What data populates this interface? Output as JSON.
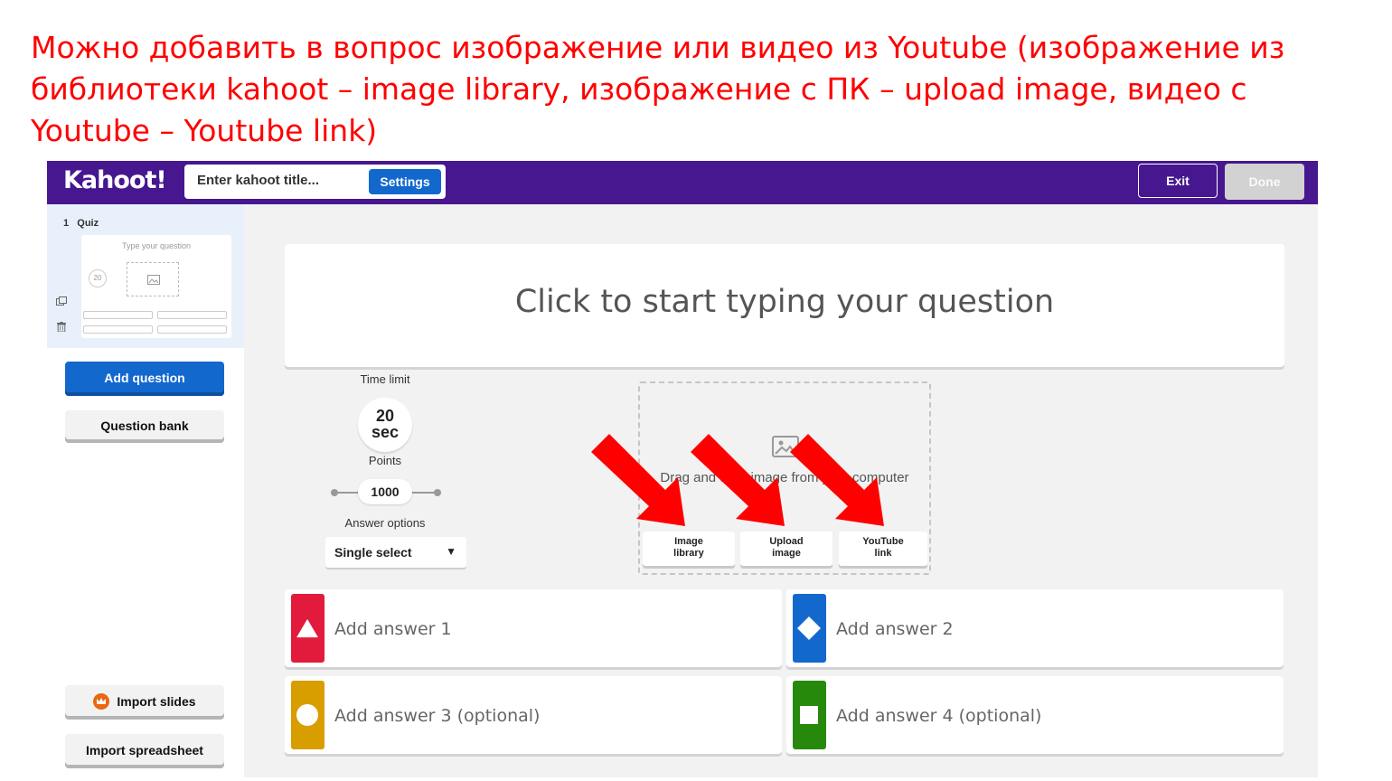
{
  "caption": {
    "text": "Можно добавить в вопрос изображение или видео из Youtube (изображение из библиотеки kahoot – image library, изображение с ПК – upload image, видео с Youtube – Youtube link)"
  },
  "topbar": {
    "logo": "Kahoot!",
    "title_placeholder": "Enter kahoot title...",
    "settings_label": "Settings",
    "exit_label": "Exit",
    "done_label": "Done"
  },
  "sidebar": {
    "slide_label": "1   Quiz",
    "thumb_question": "Type your question",
    "thumb_timer": "20",
    "add_question_label": "Add question",
    "question_bank_label": "Question bank",
    "import_slides_label": "Import slides",
    "import_spreadsheet_label": "Import spreadsheet"
  },
  "editor": {
    "question_placeholder": "Click to start typing your question",
    "time_limit_label": "Time limit",
    "time_value": "20",
    "time_unit": "sec",
    "points_label": "Points",
    "points_value": "1000",
    "answer_options_label": "Answer options",
    "answer_option_selected": "Single select",
    "media": {
      "drag_text": "Drag and drop image from your computer",
      "image_library_line1": "Image",
      "image_library_line2": "library",
      "upload_image_line1": "Upload",
      "upload_image_line2": "image",
      "youtube_link_line1": "YouTube",
      "youtube_link_line2": "link"
    },
    "answers": [
      {
        "label": "Add answer 1",
        "color": "#e21b3c",
        "shape": "triangle-icon"
      },
      {
        "label": "Add answer 2",
        "color": "#1368ce",
        "shape": "diamond-icon"
      },
      {
        "label": "Add answer 3 (optional)",
        "color": "#d89e00",
        "shape": "circle-icon"
      },
      {
        "label": "Add answer 4 (optional)",
        "color": "#26890c",
        "shape": "square-icon"
      }
    ]
  },
  "colors": {
    "topbar": "#46178f",
    "accent_blue": "#1368ce",
    "caption_red": "#ff0000",
    "annotation_arrow": "#ff0000"
  }
}
